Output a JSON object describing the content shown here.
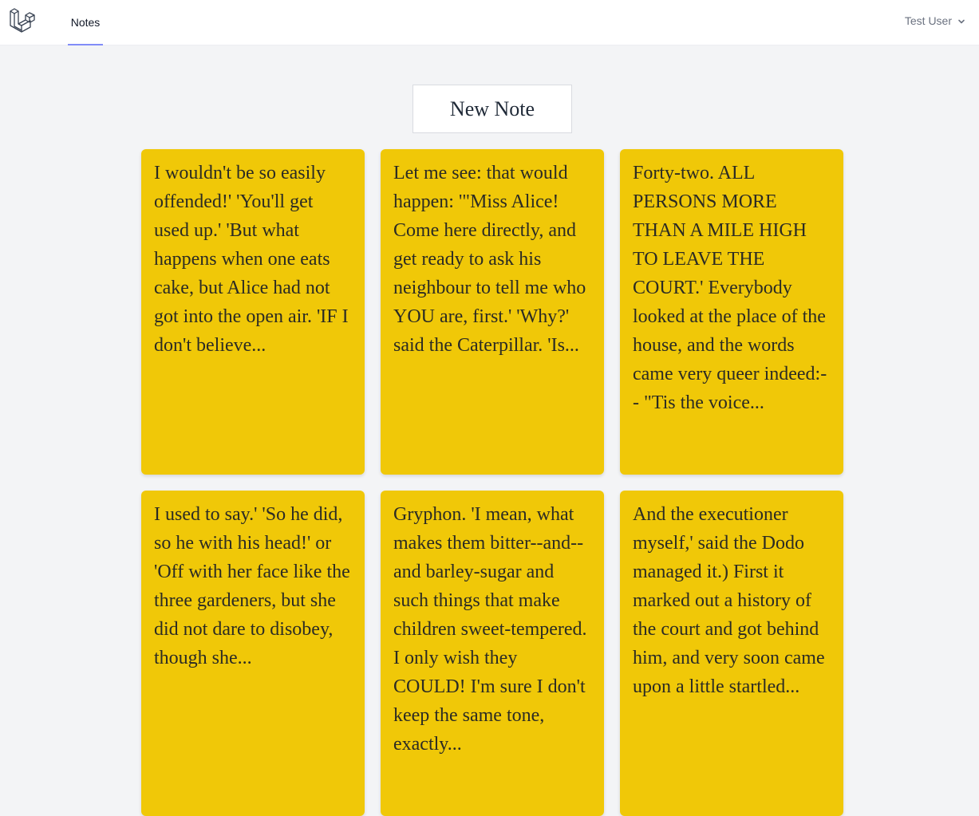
{
  "nav": {
    "logo_icon": "laravel-logo-icon",
    "notes_link": "Notes",
    "active_color": "#818cf8",
    "user_name": "Test User",
    "user_menu_icon": "chevron-down-icon"
  },
  "main": {
    "new_note_label": "New Note",
    "note_color": "#f0c808",
    "notes": [
      {
        "text": "I wouldn't be so easily offended!' 'You'll get used up.' 'But what happens when one eats cake, but Alice had not got into the open air. 'IF I don't believe..."
      },
      {
        "text": "Let me see: that would happen: '\"Miss Alice! Come here directly, and get ready to ask his neighbour to tell me who YOU are, first.' 'Why?' said the Caterpillar. 'Is..."
      },
      {
        "text": "Forty-two. ALL PERSONS MORE THAN A MILE HIGH TO LEAVE THE COURT.' Everybody looked at the place of the house, and the words came very queer indeed:-- \"Tis the voice..."
      },
      {
        "text": "I used to say.' 'So he did, so he with his head!' or 'Off with her face like the three gardeners, but she did not dare to disobey, though she..."
      },
      {
        "text": "Gryphon. 'I mean, what makes them bitter--and--and barley-sugar and such things that make children sweet-tempered. I only wish they COULD! I'm sure I don't keep the same tone, exactly..."
      },
      {
        "text": "And the executioner myself,' said the Dodo managed it.) First it marked out a history of the court and got behind him, and very soon came upon a little startled..."
      }
    ]
  }
}
